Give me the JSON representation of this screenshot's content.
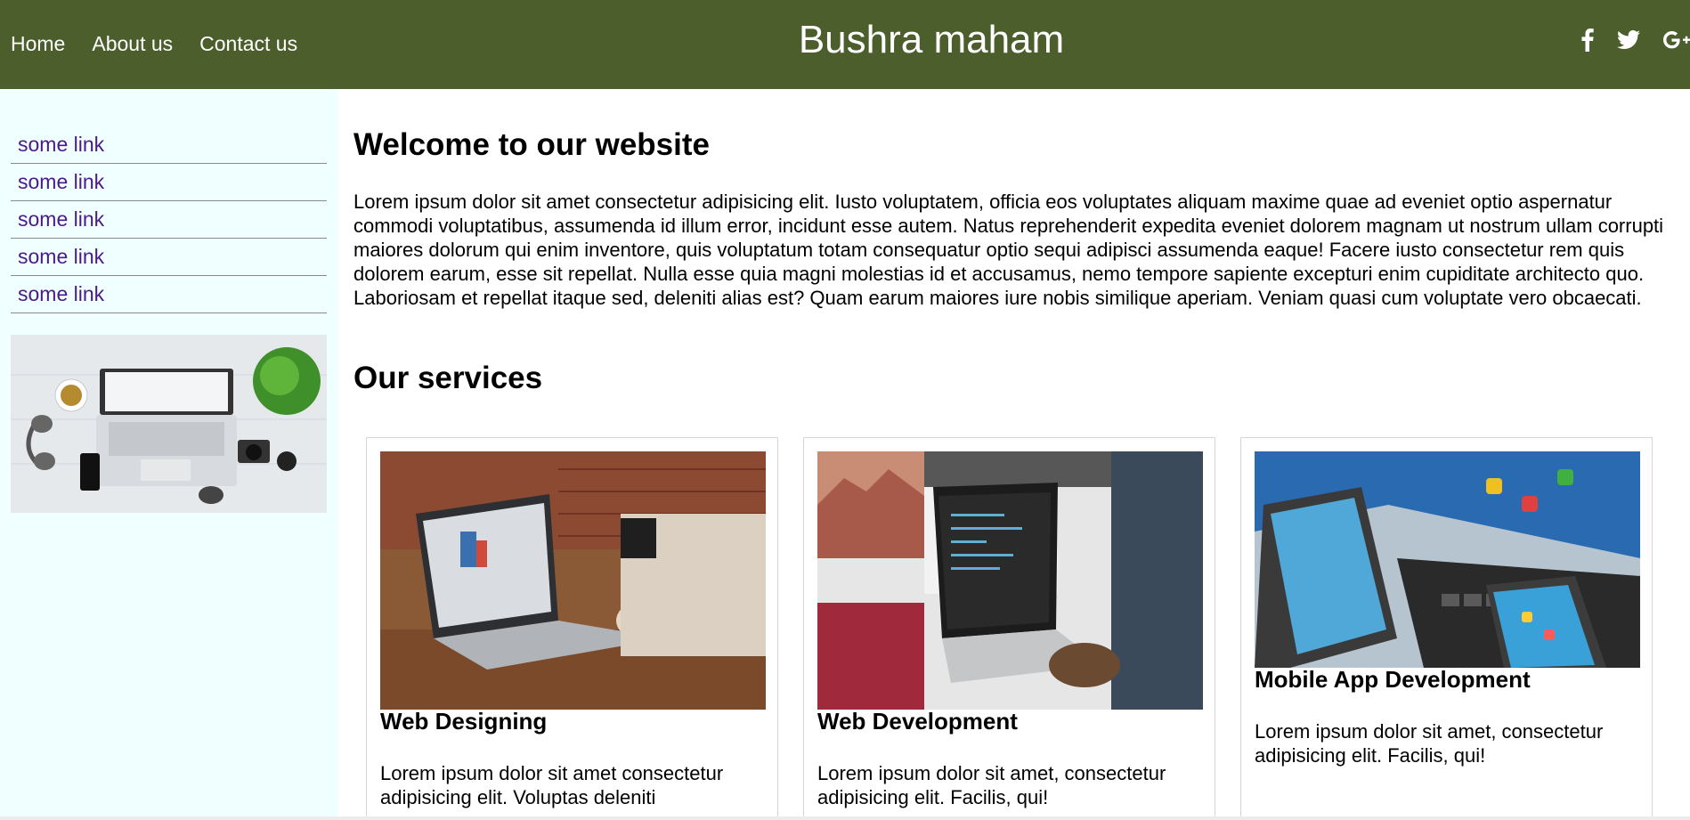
{
  "header": {
    "nav": [
      "Home",
      "About us",
      "Contact us"
    ],
    "title": "Bushra maham",
    "social_icons": [
      "facebook-icon",
      "twitter-icon",
      "google-plus-icon"
    ],
    "background_color": "#4b5e2c"
  },
  "sidebar": {
    "links": [
      "some link",
      "some link",
      "some link",
      "some link",
      "some link"
    ],
    "background_color": "#f0ffff",
    "link_color": "#4a1a8a",
    "image": "workspace-flatlay-laptop-headphones-camera"
  },
  "main": {
    "heading": "Welcome to our website",
    "intro": "Lorem ipsum dolor sit amet consectetur adipisicing elit. Iusto voluptatem, officia eos voluptates aliquam maxime quae ad eveniet optio aspernatur commodi voluptatibus, assumenda id illum error, incidunt esse autem. Natus reprehenderit expedita eveniet dolorem magnam ut nostrum ullam corrupti maiores dolorum qui enim inventore, quis voluptatum totam consequatur optio sequi adipisci assumenda eaque! Facere iusto consectetur rem quis dolorem earum, esse sit repellat. Nulla esse quia magni molestias id et accusamus, nemo tempore sapiente excepturi enim cupiditate architecto quo. Laboriosam et repellat itaque sed, deleniti alias est? Quam earum maiores iure nobis similique aperiam. Veniam quasi cum voluptate vero obcaecati.",
    "services_heading": "Our services",
    "services": [
      {
        "title": "Web Designing",
        "text": "Lorem ipsum dolor sit amet consectetur adipisicing elit. Voluptas deleniti",
        "image": "laptop-on-wooden-desk"
      },
      {
        "title": "Web Development",
        "text": "Lorem ipsum dolor sit amet, consectetur adipisicing elit. Facilis, qui!",
        "image": "laptop-with-code"
      },
      {
        "title": "Mobile App Development",
        "text": "Lorem ipsum dolor sit amet, consectetur adipisicing elit. Facilis, qui!",
        "image": "tablets-and-phones"
      }
    ]
  }
}
